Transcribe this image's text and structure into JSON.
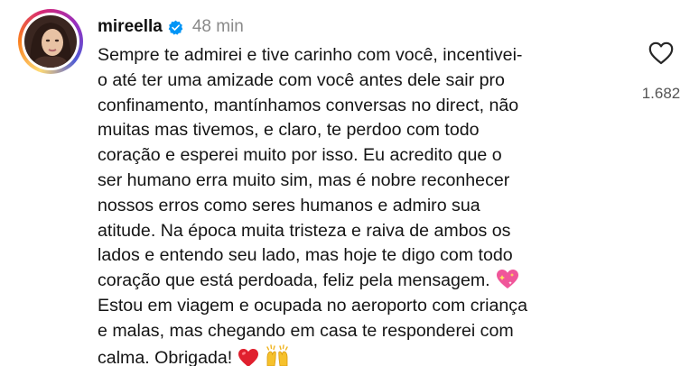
{
  "comment": {
    "username": "mireella",
    "verified": true,
    "time": "48 min",
    "lines": [
      "Sempre te admirei e tive carinho com você, incentivei-",
      "o até ter uma amizade com você antes dele sair pro",
      "confinamento, mantínhamos conversas no direct, não",
      "muitas mas tivemos, e claro, te perdoo com todo",
      "coração e esperei muito por isso. Eu acredito que o",
      "ser humano erra muito sim, mas é nobre reconhecer",
      "nossos erros como seres humanos e admiro sua",
      "atitude. Na época muita tristeza e raiva de ambos os",
      "lados e entendo seu lado, mas hoje te digo com todo",
      "coração que está perdoada, feliz pela mensagem.",
      "Estou em viagem e ocupada no aeroporto com criança",
      "e malas, mas chegando em casa te responderei com",
      "calma. Obrigada!"
    ],
    "like_count": "1.682",
    "icons": {
      "verified": "verified-badge-icon",
      "like": "heart-outline-icon",
      "sparkling_heart": "sparkling-heart-emoji",
      "red_heart": "red-heart-emoji",
      "raising_hands": "raising-hands-emoji"
    },
    "colors": {
      "verified_blue": "#0095f6",
      "time_gray": "#8a8a8a",
      "count_gray": "#555555",
      "text": "#141414"
    }
  }
}
